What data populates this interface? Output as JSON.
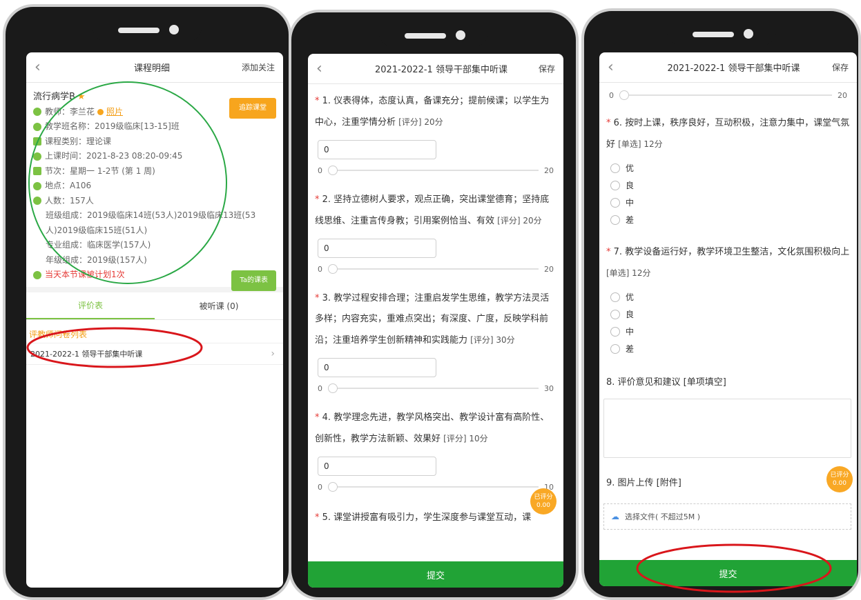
{
  "colors": {
    "accent_green": "#21a336",
    "orange": "#f7a51d",
    "annotation_red": "#d9161b",
    "annotation_green": "#2aa845"
  },
  "phone1": {
    "title": "课程明细",
    "action": "添加关注",
    "course_name": "流行病学B",
    "teacher_label": "教师：李兰花",
    "photo_link": "照片",
    "follow_btn": "追踪课堂",
    "class_name": "教学班名称：2019级临床[13-15]班",
    "category": "课程类别：理论课",
    "time": "上课时间：2021-8-23 08:20-09:45",
    "period": "节次：星期一 1-2节 (第 1 周)",
    "location": "地点：A106",
    "count": "人数：157人",
    "class_comp": "班级组成：2019级临床14班(53人)2019级临床13班(53人)2019级临床15班(51人)",
    "major_comp": "专业组成：临床医学(157人)",
    "grade_comp": "年级组成：2019级(157人)",
    "warning": "当天本节课被计划1次",
    "schedule_btn": "Ta的课表",
    "tab_eval": "评价表",
    "tab_audited": "被听课 (0)",
    "list_title": "评教师问卷列表",
    "list_item": "2021-2022-1 领导干部集中听课"
  },
  "phone2": {
    "title": "2021-2022-1 领导干部集中听课",
    "save": "保存",
    "questions": [
      {
        "num": "1.",
        "text": "仪表得体，态度认真，备课充分；提前候课；以学生为中心，注重学情分析",
        "meta": "[评分] 20分",
        "value": "0",
        "min": "0",
        "max": "20"
      },
      {
        "num": "2.",
        "text": "坚持立德树人要求，观点正确，突出课堂德育；坚持底线思维、注重言传身教；引用案例恰当、有效",
        "meta": "[评分] 20分",
        "value": "0",
        "min": "0",
        "max": "20"
      },
      {
        "num": "3.",
        "text": "教学过程安排合理；注重启发学生思维，教学方法灵活多样；内容充实，重难点突出；有深度、广度，反映学科前沿；注重培养学生创新精神和实践能力",
        "meta": "[评分] 30分",
        "value": "0",
        "min": "0",
        "max": "30"
      },
      {
        "num": "4.",
        "text": "教学理念先进，教学风格突出、教学设计富有高阶性、创新性，教学方法新颖、效果好",
        "meta": "[评分] 10分",
        "value": "0",
        "min": "0",
        "max": "10"
      }
    ],
    "cutoff_text": "5. 课堂讲授富有吸引力，学生深度参与课堂互动，课",
    "scored_label": "已评分",
    "scored_value": "0.00",
    "submit": "提交"
  },
  "phone3": {
    "title": "2021-2022-1 领导干部集中听课",
    "save": "保存",
    "slider_min": "0",
    "slider_max": "20",
    "q6": {
      "num": "6.",
      "text": "按时上课，秩序良好，互动积极，注意力集中，课堂气氛好",
      "meta": "[单选] 12分"
    },
    "q7": {
      "num": "7.",
      "text": "教学设备运行好，教学环境卫生整洁，文化氛围积极向上",
      "meta": "[单选] 12分"
    },
    "options": [
      "优",
      "良",
      "中",
      "差"
    ],
    "q8": "8. 评价意见和建议 [单项填空]",
    "q9": "9. 图片上传 [附件]",
    "upload_label": "选择文件( 不超过5M )",
    "scored_label": "已评分",
    "scored_value": "0.00",
    "submit": "提交"
  }
}
